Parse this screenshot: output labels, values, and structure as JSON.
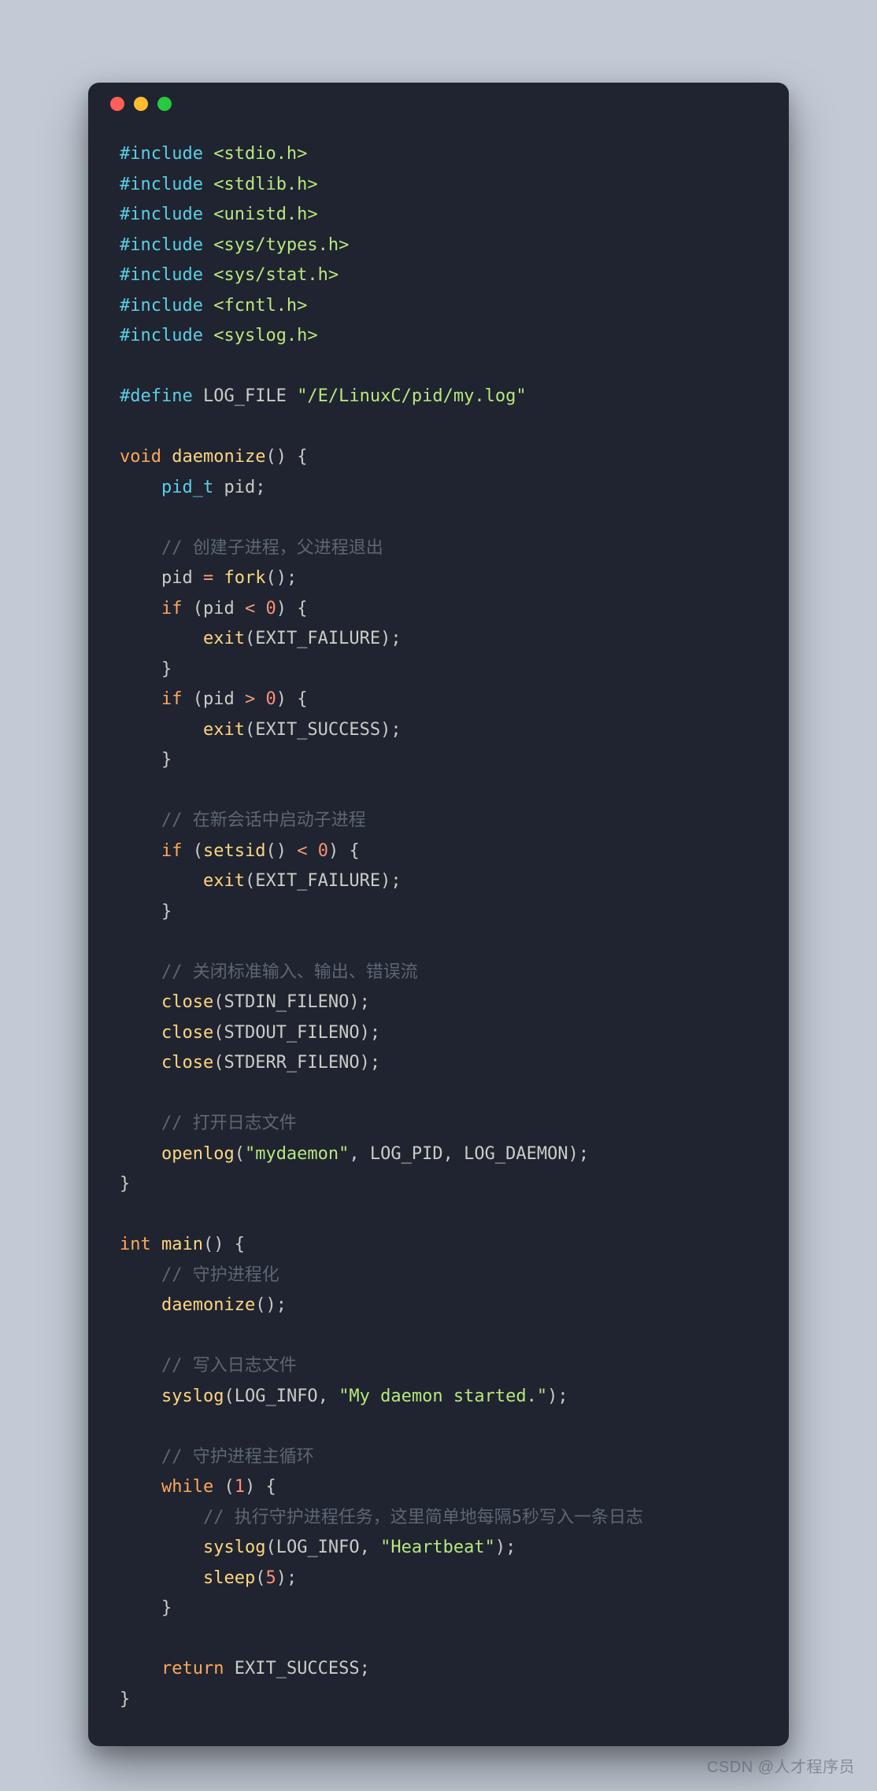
{
  "window": {
    "dots": [
      "red",
      "yellow",
      "green"
    ]
  },
  "code": {
    "lines": [
      [
        [
          "pp",
          "#include"
        ],
        [
          "sp",
          " "
        ],
        [
          "inc",
          "<stdio.h>"
        ]
      ],
      [
        [
          "pp",
          "#include"
        ],
        [
          "sp",
          " "
        ],
        [
          "inc",
          "<stdlib.h>"
        ]
      ],
      [
        [
          "pp",
          "#include"
        ],
        [
          "sp",
          " "
        ],
        [
          "inc",
          "<unistd.h>"
        ]
      ],
      [
        [
          "pp",
          "#include"
        ],
        [
          "sp",
          " "
        ],
        [
          "inc",
          "<sys/types.h>"
        ]
      ],
      [
        [
          "pp",
          "#include"
        ],
        [
          "sp",
          " "
        ],
        [
          "inc",
          "<sys/stat.h>"
        ]
      ],
      [
        [
          "pp",
          "#include"
        ],
        [
          "sp",
          " "
        ],
        [
          "inc",
          "<fcntl.h>"
        ]
      ],
      [
        [
          "pp",
          "#include"
        ],
        [
          "sp",
          " "
        ],
        [
          "inc",
          "<syslog.h>"
        ]
      ],
      [],
      [
        [
          "pp",
          "#define"
        ],
        [
          "sp",
          " "
        ],
        [
          "id",
          "LOG_FILE"
        ],
        [
          "sp",
          " "
        ],
        [
          "str",
          "\"/E/LinuxC/pid/my.log\""
        ]
      ],
      [],
      [
        [
          "kw",
          "void"
        ],
        [
          "sp",
          " "
        ],
        [
          "fn",
          "daemonize"
        ],
        [
          "pn",
          "() {"
        ]
      ],
      [
        [
          "sp",
          "    "
        ],
        [
          "type",
          "pid_t"
        ],
        [
          "sp",
          " "
        ],
        [
          "id",
          "pid"
        ],
        [
          "pn",
          ";"
        ]
      ],
      [],
      [
        [
          "sp",
          "    "
        ],
        [
          "cmt",
          "// 创建子进程，父进程退出"
        ]
      ],
      [
        [
          "sp",
          "    "
        ],
        [
          "id",
          "pid"
        ],
        [
          "sp",
          " "
        ],
        [
          "op",
          "="
        ],
        [
          "sp",
          " "
        ],
        [
          "fn",
          "fork"
        ],
        [
          "pn",
          "();"
        ]
      ],
      [
        [
          "sp",
          "    "
        ],
        [
          "kw",
          "if"
        ],
        [
          "sp",
          " "
        ],
        [
          "pn",
          "("
        ],
        [
          "id",
          "pid"
        ],
        [
          "sp",
          " "
        ],
        [
          "op",
          "<"
        ],
        [
          "sp",
          " "
        ],
        [
          "num",
          "0"
        ],
        [
          "pn",
          ") {"
        ]
      ],
      [
        [
          "sp",
          "        "
        ],
        [
          "fn",
          "exit"
        ],
        [
          "pn",
          "("
        ],
        [
          "const",
          "EXIT_FAILURE"
        ],
        [
          "pn",
          ");"
        ]
      ],
      [
        [
          "sp",
          "    "
        ],
        [
          "pn",
          "}"
        ]
      ],
      [
        [
          "sp",
          "    "
        ],
        [
          "kw",
          "if"
        ],
        [
          "sp",
          " "
        ],
        [
          "pn",
          "("
        ],
        [
          "id",
          "pid"
        ],
        [
          "sp",
          " "
        ],
        [
          "op",
          ">"
        ],
        [
          "sp",
          " "
        ],
        [
          "num",
          "0"
        ],
        [
          "pn",
          ") {"
        ]
      ],
      [
        [
          "sp",
          "        "
        ],
        [
          "fn",
          "exit"
        ],
        [
          "pn",
          "("
        ],
        [
          "const",
          "EXIT_SUCCESS"
        ],
        [
          "pn",
          ");"
        ]
      ],
      [
        [
          "sp",
          "    "
        ],
        [
          "pn",
          "}"
        ]
      ],
      [],
      [
        [
          "sp",
          "    "
        ],
        [
          "cmt",
          "// 在新会话中启动子进程"
        ]
      ],
      [
        [
          "sp",
          "    "
        ],
        [
          "kw",
          "if"
        ],
        [
          "sp",
          " "
        ],
        [
          "pn",
          "("
        ],
        [
          "fn",
          "setsid"
        ],
        [
          "pn",
          "()"
        ],
        [
          "sp",
          " "
        ],
        [
          "op",
          "<"
        ],
        [
          "sp",
          " "
        ],
        [
          "num",
          "0"
        ],
        [
          "pn",
          ") {"
        ]
      ],
      [
        [
          "sp",
          "        "
        ],
        [
          "fn",
          "exit"
        ],
        [
          "pn",
          "("
        ],
        [
          "const",
          "EXIT_FAILURE"
        ],
        [
          "pn",
          ");"
        ]
      ],
      [
        [
          "sp",
          "    "
        ],
        [
          "pn",
          "}"
        ]
      ],
      [],
      [
        [
          "sp",
          "    "
        ],
        [
          "cmt",
          "// 关闭标准输入、输出、错误流"
        ]
      ],
      [
        [
          "sp",
          "    "
        ],
        [
          "fn",
          "close"
        ],
        [
          "pn",
          "("
        ],
        [
          "const",
          "STDIN_FILENO"
        ],
        [
          "pn",
          ");"
        ]
      ],
      [
        [
          "sp",
          "    "
        ],
        [
          "fn",
          "close"
        ],
        [
          "pn",
          "("
        ],
        [
          "const",
          "STDOUT_FILENO"
        ],
        [
          "pn",
          ");"
        ]
      ],
      [
        [
          "sp",
          "    "
        ],
        [
          "fn",
          "close"
        ],
        [
          "pn",
          "("
        ],
        [
          "const",
          "STDERR_FILENO"
        ],
        [
          "pn",
          ");"
        ]
      ],
      [],
      [
        [
          "sp",
          "    "
        ],
        [
          "cmt",
          "// 打开日志文件"
        ]
      ],
      [
        [
          "sp",
          "    "
        ],
        [
          "fn",
          "openlog"
        ],
        [
          "pn",
          "("
        ],
        [
          "str",
          "\"mydaemon\""
        ],
        [
          "pn",
          ", "
        ],
        [
          "const",
          "LOG_PID"
        ],
        [
          "pn",
          ", "
        ],
        [
          "const",
          "LOG_DAEMON"
        ],
        [
          "pn",
          ");"
        ]
      ],
      [
        [
          "pn",
          "}"
        ]
      ],
      [],
      [
        [
          "kw",
          "int"
        ],
        [
          "sp",
          " "
        ],
        [
          "fn",
          "main"
        ],
        [
          "pn",
          "() {"
        ]
      ],
      [
        [
          "sp",
          "    "
        ],
        [
          "cmt",
          "// 守护进程化"
        ]
      ],
      [
        [
          "sp",
          "    "
        ],
        [
          "fn",
          "daemonize"
        ],
        [
          "pn",
          "();"
        ]
      ],
      [],
      [
        [
          "sp",
          "    "
        ],
        [
          "cmt",
          "// 写入日志文件"
        ]
      ],
      [
        [
          "sp",
          "    "
        ],
        [
          "fn",
          "syslog"
        ],
        [
          "pn",
          "("
        ],
        [
          "const",
          "LOG_INFO"
        ],
        [
          "pn",
          ", "
        ],
        [
          "str",
          "\"My daemon started.\""
        ],
        [
          "pn",
          ");"
        ]
      ],
      [],
      [
        [
          "sp",
          "    "
        ],
        [
          "cmt",
          "// 守护进程主循环"
        ]
      ],
      [
        [
          "sp",
          "    "
        ],
        [
          "kw",
          "while"
        ],
        [
          "sp",
          " "
        ],
        [
          "pn",
          "("
        ],
        [
          "num",
          "1"
        ],
        [
          "pn",
          ") {"
        ]
      ],
      [
        [
          "sp",
          "        "
        ],
        [
          "cmt",
          "// 执行守护进程任务，这里简单地每隔5秒写入一条日志"
        ]
      ],
      [
        [
          "sp",
          "        "
        ],
        [
          "fn",
          "syslog"
        ],
        [
          "pn",
          "("
        ],
        [
          "const",
          "LOG_INFO"
        ],
        [
          "pn",
          ", "
        ],
        [
          "str",
          "\"Heartbeat\""
        ],
        [
          "pn",
          ");"
        ]
      ],
      [
        [
          "sp",
          "        "
        ],
        [
          "fn",
          "sleep"
        ],
        [
          "pn",
          "("
        ],
        [
          "num",
          "5"
        ],
        [
          "pn",
          ");"
        ]
      ],
      [
        [
          "sp",
          "    "
        ],
        [
          "pn",
          "}"
        ]
      ],
      [],
      [
        [
          "sp",
          "    "
        ],
        [
          "kw",
          "return"
        ],
        [
          "sp",
          " "
        ],
        [
          "const",
          "EXIT_SUCCESS"
        ],
        [
          "pn",
          ";"
        ]
      ],
      [
        [
          "pn",
          "}"
        ]
      ]
    ]
  },
  "watermark": "CSDN @人才程序员"
}
